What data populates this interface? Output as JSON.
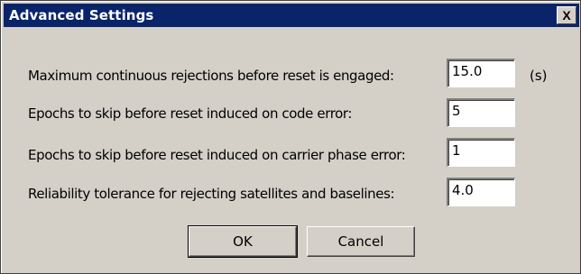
{
  "window": {
    "title": "Advanced Settings",
    "close_label": "X"
  },
  "settings": [
    {
      "label": "Maximum continuous rejections before reset is engaged:",
      "value": "15.0",
      "unit": "(s)"
    },
    {
      "label": "Epochs to skip before reset induced on code error:",
      "value": "5"
    },
    {
      "label": "Epochs to skip before reset induced on carrier phase error:",
      "value": "1"
    },
    {
      "label": "Reliability tolerance for rejecting satellites and baselines:",
      "value": "4.0"
    }
  ],
  "buttons": {
    "ok_label": "OK",
    "cancel_label": "Cancel"
  }
}
